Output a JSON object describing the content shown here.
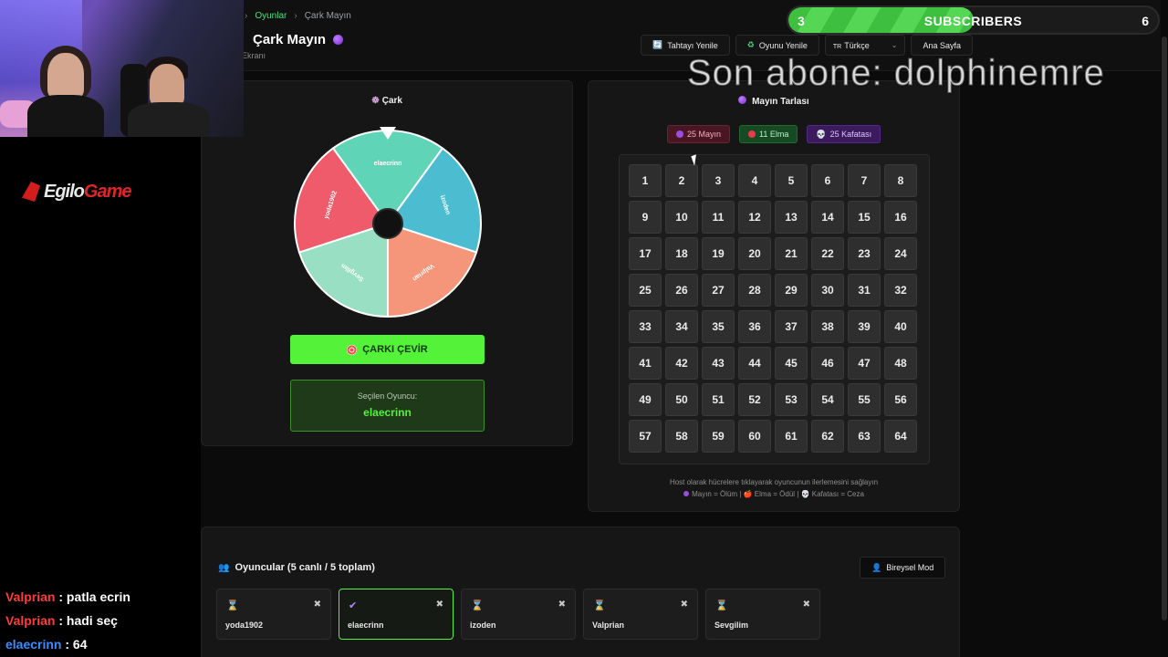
{
  "breadcrumb": {
    "games": "Oyunlar",
    "current": "Çark Mayın"
  },
  "page": {
    "title": "Çark Mayın",
    "subtitle": "t Ekranı"
  },
  "toolbar": {
    "refresh_board": "Tahtayı Yenile",
    "refresh_game": "Oyunu Yenile",
    "language": "Türkçe",
    "language_flag": "TR",
    "home": "Ana Sayfa"
  },
  "wheel": {
    "title": "Çark",
    "segments": [
      {
        "name": "elaecrinn",
        "color": "#5fd4b6"
      },
      {
        "name": "izoden",
        "color": "#4cbcd0"
      },
      {
        "name": "Valprian",
        "color": "#f5957a"
      },
      {
        "name": "Sevgilim",
        "color": "#98dfc4"
      },
      {
        "name": "yoda1902",
        "color": "#ef5b6a"
      }
    ],
    "spin_label": "ÇARKI ÇEVİR",
    "selected_label": "Seçilen Oyuncu:",
    "selected_value": "elaecrinn"
  },
  "board": {
    "title": "Mayın Tarlası",
    "counts": {
      "mines": "25 Mayın",
      "apples": "11 Elma",
      "skulls": "25 Kafatası"
    },
    "cells": [
      "1",
      "2",
      "3",
      "4",
      "5",
      "6",
      "7",
      "8",
      "9",
      "10",
      "11",
      "12",
      "13",
      "14",
      "15",
      "16",
      "17",
      "18",
      "19",
      "20",
      "21",
      "22",
      "23",
      "24",
      "25",
      "26",
      "27",
      "28",
      "29",
      "30",
      "31",
      "32",
      "33",
      "34",
      "35",
      "36",
      "37",
      "38",
      "39",
      "40",
      "41",
      "42",
      "43",
      "44",
      "45",
      "46",
      "47",
      "48",
      "49",
      "50",
      "51",
      "52",
      "53",
      "54",
      "55",
      "56",
      "57",
      "58",
      "59",
      "60",
      "61",
      "62",
      "63",
      "64"
    ],
    "hint_line1": "Host olarak hücrelere tıklayarak oyuncunun ilerlemesini sağlayın",
    "hint_line2": "Mayın = Ölüm | 🍎 Elma = Ödül | 💀 Kafatası = Ceza"
  },
  "players": {
    "title": "Oyuncular (5 canlı / 5 toplam)",
    "mode_button": "Bireysel Mod",
    "list": [
      {
        "name": "yoda1902",
        "status": "⌛",
        "active": false
      },
      {
        "name": "elaecrinn",
        "status": "✔",
        "active": true
      },
      {
        "name": "izoden",
        "status": "⌛",
        "active": false
      },
      {
        "name": "Valprian",
        "status": "⌛",
        "active": false
      },
      {
        "name": "Sevgilim",
        "status": "⌛",
        "active": false
      }
    ]
  },
  "overlay": {
    "logo_left": "Egilo",
    "logo_right": "Game",
    "subscribers": {
      "current": "3",
      "label": "SUBSCRIBERS",
      "goal": "6",
      "progress": 0.5
    },
    "last_subscriber": "Son abone: dolphinemre",
    "chat": [
      {
        "user": "Valprian",
        "message": " : patla ecrin",
        "color": "#ff3b3b"
      },
      {
        "user": "Valprian",
        "message": " : hadi seç",
        "color": "#ff3b3b"
      },
      {
        "user": "elaecrinn",
        "message": " : 64",
        "color": "#3c8cff"
      }
    ]
  }
}
